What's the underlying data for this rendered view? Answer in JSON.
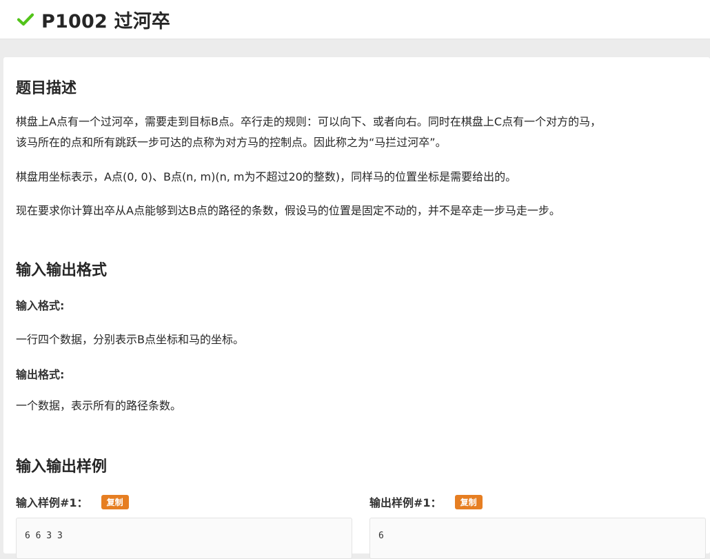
{
  "header": {
    "title": "P1002 过河卒",
    "status_icon": "check-icon",
    "status_color": "#52c41a"
  },
  "description": {
    "heading": "题目描述",
    "para1_line1": "棋盘上A点有一个过河卒，需要走到目标B点。卒行走的规则：可以向下、或者向右。同时在棋盘上C点有一个对方的马，",
    "para1_line2": "该马所在的点和所有跳跃一步可达的点称为对方马的控制点。因此称之为“马拦过河卒”。",
    "para2": "棋盘用坐标表示，A点(0, 0)、B点(n, m)(n, m为不超过20的整数)，同样马的位置坐标是需要给出的。",
    "para3": "现在要求你计算出卒从A点能够到达B点的路径的条数，假设马的位置是固定不动的，并不是卒走一步马走一步。"
  },
  "io_format": {
    "heading": "输入输出格式",
    "input_label": "输入格式:",
    "input_text": "一行四个数据，分别表示B点坐标和马的坐标。",
    "output_label": "输出格式:",
    "output_text": "一个数据，表示所有的路径条数。"
  },
  "samples": {
    "heading": "输入输出样例",
    "input_label": "输入样例#1：",
    "output_label": "输出样例#1：",
    "copy_label": "复制",
    "input_value": "6 6 3 3",
    "output_value": "6",
    "copy_color": "#e67e22"
  }
}
